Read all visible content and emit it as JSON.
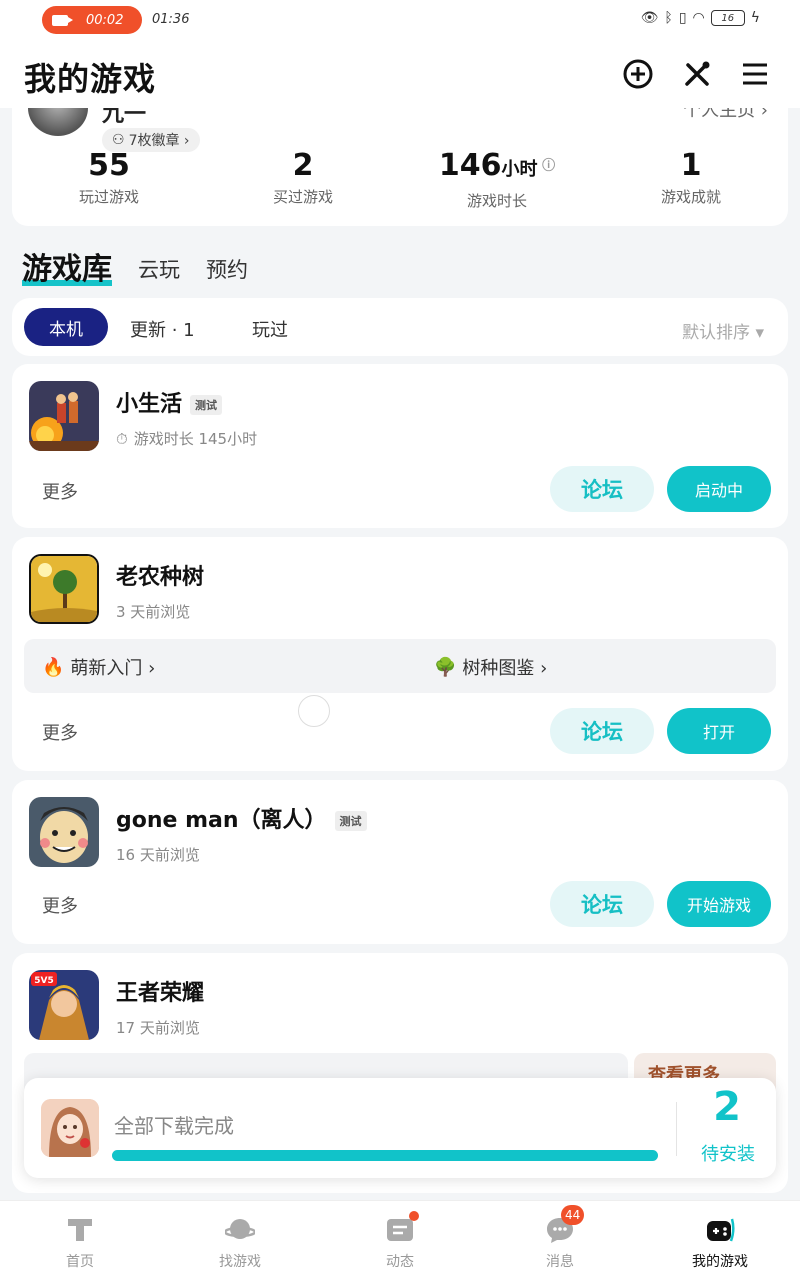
{
  "status_bar": {
    "recording_time": "00:02",
    "clock": "01:36",
    "battery": "16"
  },
  "header": {
    "title": "我的游戏"
  },
  "profile": {
    "name": "九一",
    "link": "个人主页 ›",
    "badges": "7枚徽章 ›",
    "stats": [
      {
        "value": "55",
        "unit": "",
        "label": "玩过游戏"
      },
      {
        "value": "2",
        "unit": "",
        "label": "买过游戏"
      },
      {
        "value": "146",
        "unit": "小时",
        "label": "游戏时长"
      },
      {
        "value": "1",
        "unit": "",
        "label": "游戏成就"
      }
    ]
  },
  "library_tabs": [
    "游戏库",
    "云玩",
    "预约"
  ],
  "filter": {
    "active": "本机",
    "update": "更新 · 1",
    "played": "玩过",
    "sort": "默认排序 ▾"
  },
  "games": [
    {
      "name": "小生活",
      "tag": "测试",
      "sub": "游戏时长 145小时",
      "more": "更多",
      "forum": "论坛",
      "action": "启动中"
    },
    {
      "name": "老农种树",
      "tag": "",
      "sub": "3 天前浏览",
      "more": "更多",
      "forum": "论坛",
      "action": "打开",
      "guides": [
        "萌新入门 ›",
        "树种图鉴 ›"
      ]
    },
    {
      "name": "gone man（离人）",
      "tag": "测试",
      "sub": "16 天前浏览",
      "more": "更多",
      "forum": "论坛",
      "action": "开始游戏"
    },
    {
      "name": "王者荣耀",
      "tag": "",
      "sub": "17 天前浏览",
      "guides": [
        "",
        "",
        "查看更多"
      ]
    }
  ],
  "download": {
    "status": "全部下载完成",
    "progress": 1.0,
    "pending_count": "2",
    "pending_label": "待安装"
  },
  "bottom_nav": [
    {
      "label": "首页",
      "icon": "home-icon"
    },
    {
      "label": "找游戏",
      "icon": "planet-icon"
    },
    {
      "label": "动态",
      "icon": "feed-icon"
    },
    {
      "label": "消息",
      "icon": "message-icon",
      "badge": "44"
    },
    {
      "label": "我的游戏",
      "icon": "gamepad-icon"
    }
  ],
  "colors": {
    "accent": "#11c3c9",
    "chip": "#1a2283",
    "badge": "#f0502a"
  }
}
